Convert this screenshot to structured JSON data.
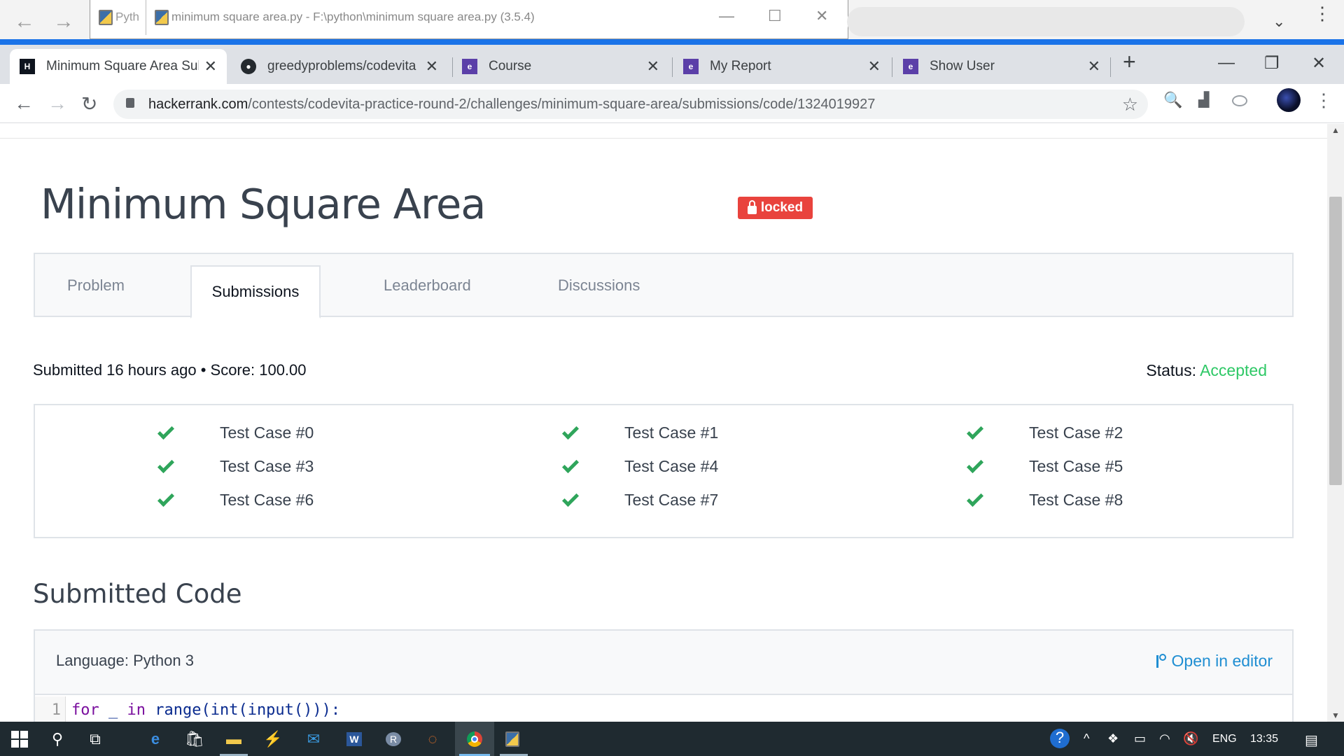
{
  "background_window": {
    "tab_label": "Pyth",
    "title": "minimum square area.py - F:\\python\\minimum square area.py (3.5.4)"
  },
  "browser": {
    "tabs": [
      {
        "label": "Minimum Square Area Sub",
        "icon": "hackerrank-icon",
        "active": true
      },
      {
        "label": "greedyproblems/codevita a",
        "icon": "github-icon",
        "active": false
      },
      {
        "label": "Course",
        "icon": "e-icon",
        "active": false
      },
      {
        "label": "My Report",
        "icon": "e-icon",
        "active": false
      },
      {
        "label": "Show User",
        "icon": "e-icon",
        "active": false
      }
    ],
    "url_host": "hackerrank.com",
    "url_path": "/contests/codevita-practice-round-2/challenges/minimum-square-area/submissions/code/1324019927"
  },
  "challenge": {
    "title": "Minimum Square Area",
    "badge": "locked",
    "tabs": [
      "Problem",
      "Submissions",
      "Leaderboard",
      "Discussions"
    ],
    "active_tab": "Submissions",
    "submitted": "Submitted 16 hours ago • Score: 100.00",
    "status_label": "Status:",
    "status_value": "Accepted",
    "test_cases": [
      "Test Case #0",
      "Test Case #1",
      "Test Case #2",
      "Test Case #3",
      "Test Case #4",
      "Test Case #5",
      "Test Case #6",
      "Test Case #7",
      "Test Case #8"
    ],
    "code_heading": "Submitted Code",
    "language": "Language: Python 3",
    "open_in_editor": "Open in editor",
    "code_lines": [
      {
        "num": "1",
        "text": "for _ in range(int(input())):"
      }
    ]
  },
  "taskbar": {
    "language": "ENG",
    "time": "13:35",
    "icons": [
      "windows-start-icon",
      "search-icon",
      "task-view-icon",
      "edge-icon",
      "store-icon",
      "file-explorer-icon",
      "vscode-icon",
      "mail-icon",
      "word-icon",
      "r-icon",
      "jupyter-icon",
      "chrome-icon",
      "python-idle-icon"
    ]
  },
  "colors": {
    "accent_blue": "#1a73e8",
    "badge_red": "#e9433d",
    "accepted_green": "#2ec866",
    "check_green": "#2fa55b",
    "link_blue": "#1f8ed2"
  }
}
